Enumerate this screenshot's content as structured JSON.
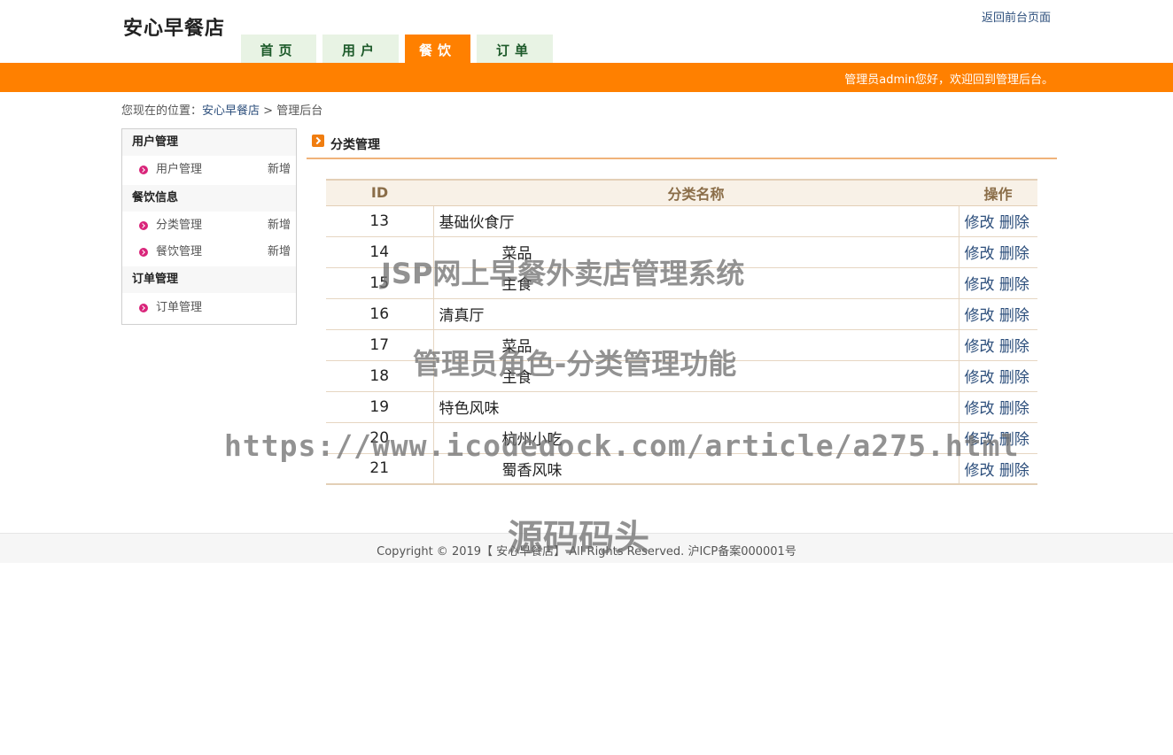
{
  "header": {
    "logo": "安心早餐店",
    "back_link": "返回前台页面",
    "tabs": [
      {
        "label": "首页",
        "active": false
      },
      {
        "label": "用户",
        "active": false
      },
      {
        "label": "餐饮",
        "active": true
      },
      {
        "label": "订单",
        "active": false
      }
    ],
    "welcome": "管理员admin您好，欢迎回到管理后台。",
    "accent_color": "#ff8000"
  },
  "breadcrumb": {
    "prefix": "您现在的位置：",
    "home": "安心早餐店",
    "separator": ">",
    "current": "管理后台"
  },
  "sidebar": {
    "groups": [
      {
        "title": "用户管理",
        "items": [
          {
            "label": "用户管理",
            "add": "新增"
          }
        ]
      },
      {
        "title": "餐饮信息",
        "items": [
          {
            "label": "分类管理",
            "add": "新增"
          },
          {
            "label": "餐饮管理",
            "add": "新增"
          }
        ]
      },
      {
        "title": "订单管理",
        "items": [
          {
            "label": "订单管理",
            "add": ""
          }
        ]
      }
    ]
  },
  "main": {
    "title": "分类管理",
    "columns": [
      "ID",
      "分类名称",
      "操作"
    ],
    "rows": [
      {
        "id": "13",
        "name": "基础伙食厅",
        "child": false
      },
      {
        "id": "14",
        "name": "菜品",
        "child": true
      },
      {
        "id": "15",
        "name": "主食",
        "child": true
      },
      {
        "id": "16",
        "name": "清真厅",
        "child": false
      },
      {
        "id": "17",
        "name": "菜品",
        "child": true
      },
      {
        "id": "18",
        "name": "主食",
        "child": true
      },
      {
        "id": "19",
        "name": "特色风味",
        "child": false
      },
      {
        "id": "20",
        "name": "杭州小吃",
        "child": true
      },
      {
        "id": "21",
        "name": "蜀香风味",
        "child": true
      }
    ],
    "edit_label": "修改",
    "delete_label": "删除"
  },
  "footer": {
    "copyright": "Copyright © 2019【 安心早餐店】 All Rights Reserved. 沪ICP备案000001号"
  },
  "watermarks": [
    "JSP网上早餐外卖店管理系统",
    "管理员角色-分类管理功能",
    "https://www.icodedock.com/article/a275.html",
    "源码码头"
  ]
}
